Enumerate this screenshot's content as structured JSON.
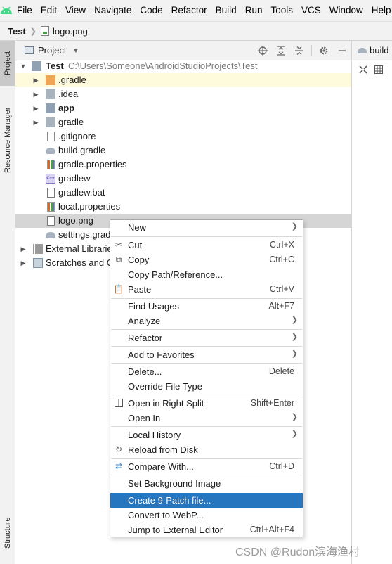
{
  "menubar": {
    "items": [
      "File",
      "Edit",
      "View",
      "Navigate",
      "Code",
      "Refactor",
      "Build",
      "Run",
      "Tools",
      "VCS",
      "Window",
      "Help"
    ]
  },
  "navbar": {
    "project": "Test",
    "file": "logo.png"
  },
  "toolstrip": {
    "project": "Project",
    "resource_manager": "Resource Manager",
    "structure": "Structure"
  },
  "project_panel": {
    "title": "Project"
  },
  "editor": {
    "tab_label": "build"
  },
  "tree": {
    "root": {
      "name": "Test",
      "path": "C:\\Users\\Someone\\AndroidStudioProjects\\Test"
    },
    "items": [
      ".gradle",
      ".idea",
      "app",
      "gradle",
      ".gitignore",
      "build.gradle",
      "gradle.properties",
      "gradlew",
      "gradlew.bat",
      "local.properties",
      "logo.png",
      "settings.grad"
    ],
    "external_libraries": "External Librarie",
    "scratches": "Scratches and C"
  },
  "context_menu": {
    "items": [
      {
        "label": "New",
        "shortcut": ""
      },
      {
        "label": "Cut",
        "shortcut": "Ctrl+X"
      },
      {
        "label": "Copy",
        "shortcut": "Ctrl+C"
      },
      {
        "label": "Copy Path/Reference...",
        "shortcut": ""
      },
      {
        "label": "Paste",
        "shortcut": "Ctrl+V"
      },
      {
        "label": "Find Usages",
        "shortcut": "Alt+F7"
      },
      {
        "label": "Analyze",
        "shortcut": ""
      },
      {
        "label": "Refactor",
        "shortcut": ""
      },
      {
        "label": "Add to Favorites",
        "shortcut": ""
      },
      {
        "label": "Delete...",
        "shortcut": "Delete"
      },
      {
        "label": "Override File Type",
        "shortcut": ""
      },
      {
        "label": "Open in Right Split",
        "shortcut": "Shift+Enter"
      },
      {
        "label": "Open In",
        "shortcut": ""
      },
      {
        "label": "Local History",
        "shortcut": ""
      },
      {
        "label": "Reload from Disk",
        "shortcut": ""
      },
      {
        "label": "Compare With...",
        "shortcut": "Ctrl+D"
      },
      {
        "label": "Set Background Image",
        "shortcut": ""
      },
      {
        "label": "Create 9-Patch file...",
        "shortcut": ""
      },
      {
        "label": "Convert to WebP...",
        "shortcut": ""
      },
      {
        "label": "Jump to External Editor",
        "shortcut": "Ctrl+Alt+F4"
      }
    ]
  },
  "watermark": "CSDN @Rudon滨海渔村",
  "colors": {
    "selection": "#2675bf",
    "app_logo": "#3ddc84"
  },
  "icons": [
    "android-logo-icon",
    "target-icon",
    "expand-all-icon",
    "collapse-all-icon",
    "gear-icon",
    "minimize-icon",
    "scissors-icon",
    "copy-icon",
    "paste-icon",
    "split-icon",
    "reload-icon",
    "compare-icon"
  ]
}
